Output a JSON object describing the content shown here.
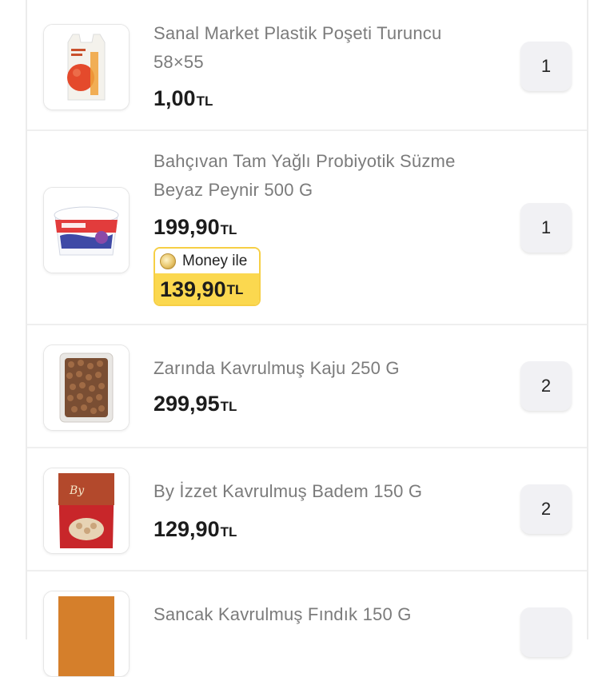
{
  "items": [
    {
      "name_line1": "Sanal Market Plastik Poşeti Turuncu",
      "name_line2": "58×55",
      "price": "1,00",
      "currency": "TL",
      "quantity": "1",
      "image": "plastic-bag-image"
    },
    {
      "name_line1": "Bahçıvan Tam Yağlı Probiyotik Süzme",
      "name_line2": "Beyaz Peynir 500 G",
      "price": "199,90",
      "currency": "TL",
      "quantity": "1",
      "image": "cheese-tub-image",
      "money": {
        "label": "Money ile",
        "price": "139,90",
        "currency": "TL",
        "icon": "money-coin-icon"
      }
    },
    {
      "name_line1": "Zarında Kavrulmuş Kaju 250 G",
      "price": "299,95",
      "currency": "TL",
      "quantity": "2",
      "image": "cashew-tray-image"
    },
    {
      "name_line1": "By İzzet Kavrulmuş Badem 150 G",
      "price": "129,90",
      "currency": "TL",
      "quantity": "2",
      "image": "almond-pack-image"
    },
    {
      "name_line1": "Sancak Kavrulmuş Fındık 150 G",
      "image": "hazelnut-pack-image"
    }
  ],
  "colors": {
    "money_badge": "#fbd84f",
    "money_border": "#f6cf45",
    "qty_bg": "#f1f1f4",
    "name_text": "#7b7b7b",
    "price_text": "#1c1c1c"
  }
}
